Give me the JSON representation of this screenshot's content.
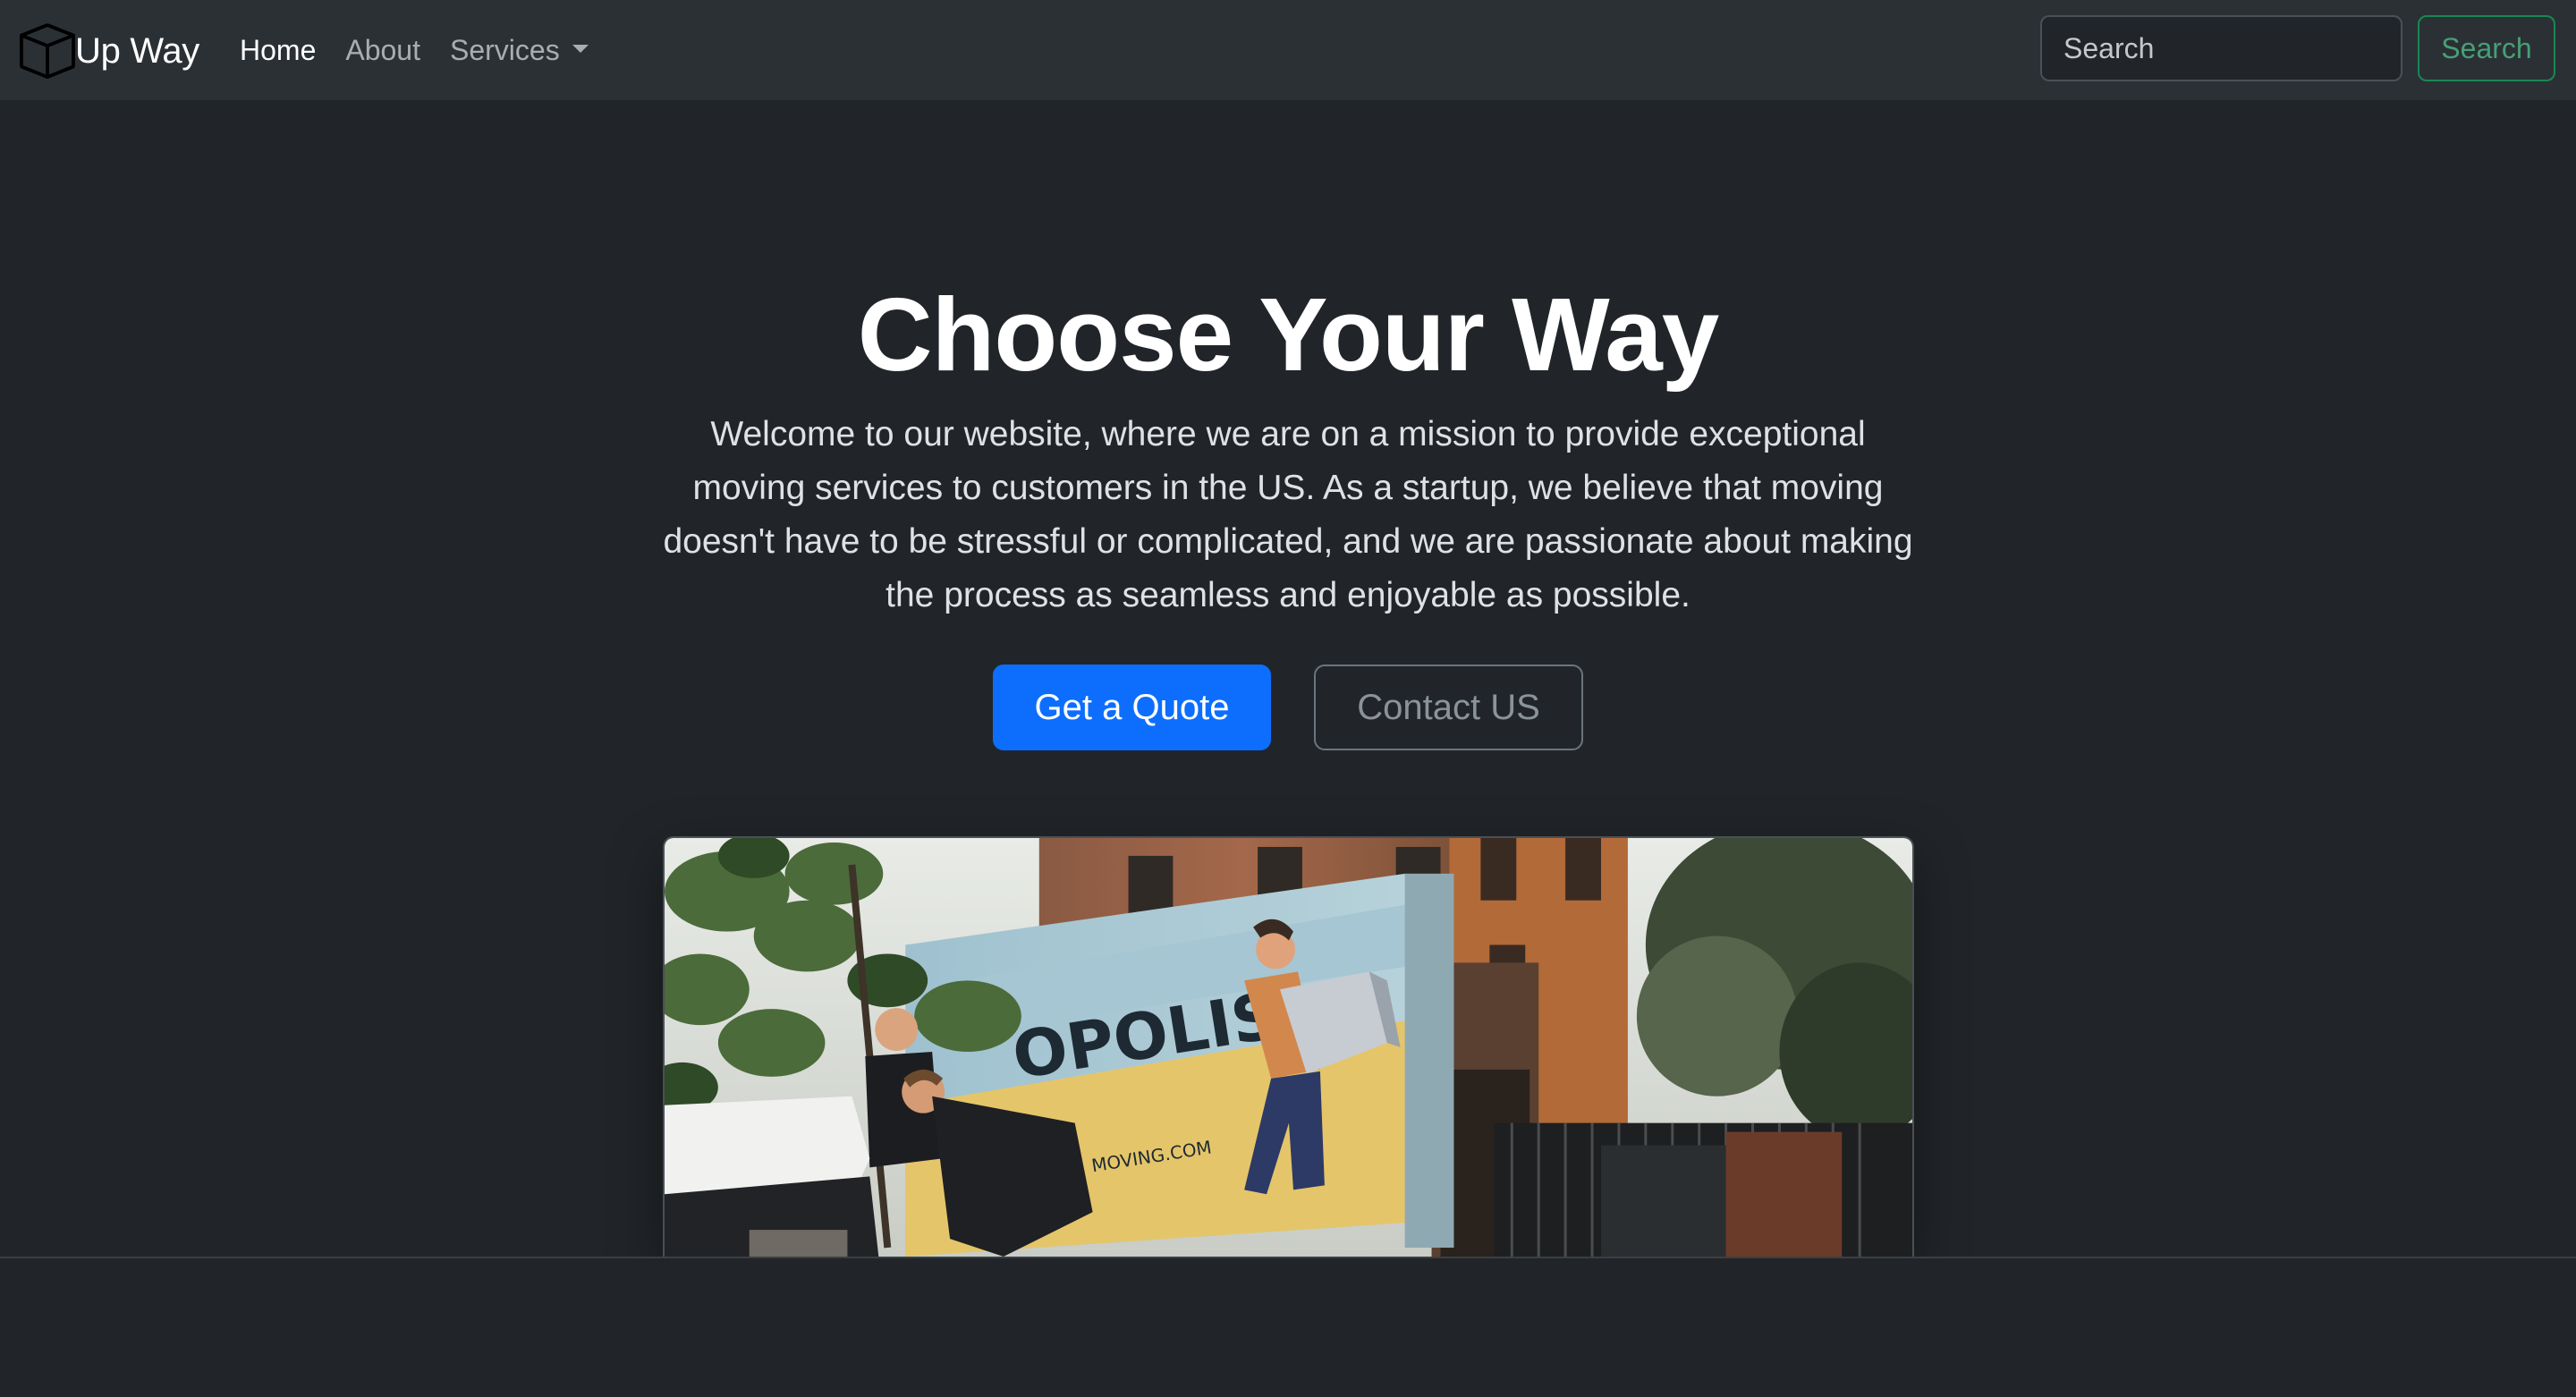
{
  "navbar": {
    "brand": "Up Way",
    "brand_icon": "box-icon",
    "links": [
      {
        "label": "Home",
        "active": true
      },
      {
        "label": "About",
        "active": false
      },
      {
        "label": "Services",
        "active": false,
        "dropdown": true
      }
    ],
    "search_placeholder": "Search",
    "search_button": "Search"
  },
  "hero": {
    "title": "Choose Your Way",
    "lead": "Welcome to our website, where we are on a mission to provide exceptional moving services to customers in the US. As a startup, we believe that moving doesn't have to be stressful or complicated, and we are passionate about making the process as seamless and enjoyable as possible.",
    "primary_button": "Get a Quote",
    "secondary_button": "Contact US",
    "image_icon": "moving-truck-photo"
  },
  "colors": {
    "background": "#212529",
    "navbar": "#2b3035",
    "primary": "#0d6efd",
    "success_outline": "#198754"
  }
}
